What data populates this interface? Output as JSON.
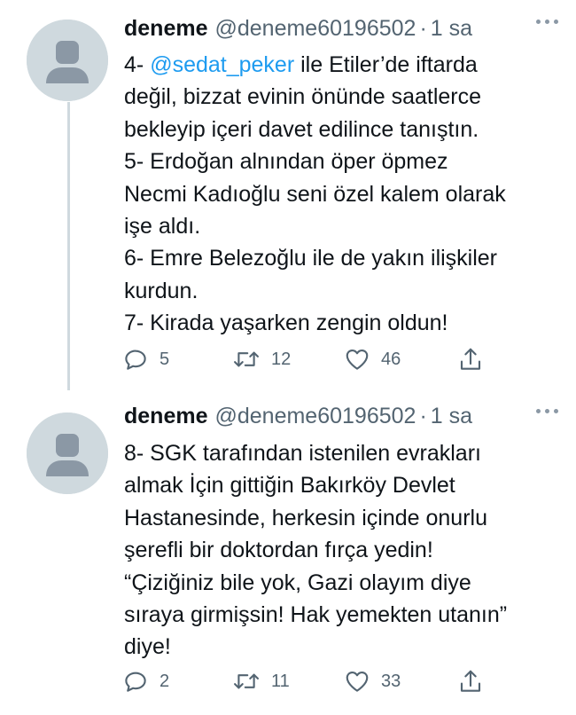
{
  "tweets": [
    {
      "display_name": "deneme",
      "handle": "@deneme60196502",
      "separator": "·",
      "time": "1 sa",
      "lines": [
        {
          "mention": "@sedat_peker",
          "prefix": "4- ",
          "text": " ile Etiler’de iftarda"
        },
        {
          "text": "değil, bizzat evinin önünde saatlerce"
        },
        {
          "text": "bekleyip içeri davet edilince tanıştın."
        },
        {
          "text": "5- Erdoğan alnından öper öpmez"
        },
        {
          "text": "Necmi Kadıoğlu seni özel kalem olarak"
        },
        {
          "text": "işe aldı."
        },
        {
          "text": "6- Emre Belezoğlu ile de yakın ilişkiler"
        },
        {
          "text": "kurdun."
        },
        {
          "text": "7- Kirada yaşarken zengin oldun!"
        }
      ],
      "replies": "5",
      "retweets": "12",
      "likes": "46"
    },
    {
      "display_name": "deneme",
      "handle": "@deneme60196502",
      "separator": "·",
      "time": "1 sa",
      "lines": [
        {
          "text": "8- SGK tarafından istenilen evrakları"
        },
        {
          "text": "almak İçin gittiğin Bakırköy Devlet"
        },
        {
          "text": "Hastanesinde, herkesin içinde onurlu"
        },
        {
          "text": "şerefli bir doktordan fırça yedin!"
        },
        {
          "text": "“Çiziğiniz bile yok, Gazi olayım diye"
        },
        {
          "text": "sıraya girmişsin! Hak yemekten utanın”"
        },
        {
          "text": "diye!"
        }
      ],
      "replies": "2",
      "retweets": "11",
      "likes": "33"
    }
  ],
  "icons": {
    "reply": "reply-icon",
    "retweet": "retweet-icon",
    "like": "heart-icon",
    "share": "share-icon",
    "more": "more-icon",
    "avatar": "default-avatar-icon"
  },
  "colors": {
    "text": "#0f1419",
    "secondary": "#536471",
    "link": "#1d9bf0",
    "thread_line": "#cfd9de",
    "avatar_bg": "#cfd9de",
    "avatar_fg": "#8b98a5"
  }
}
